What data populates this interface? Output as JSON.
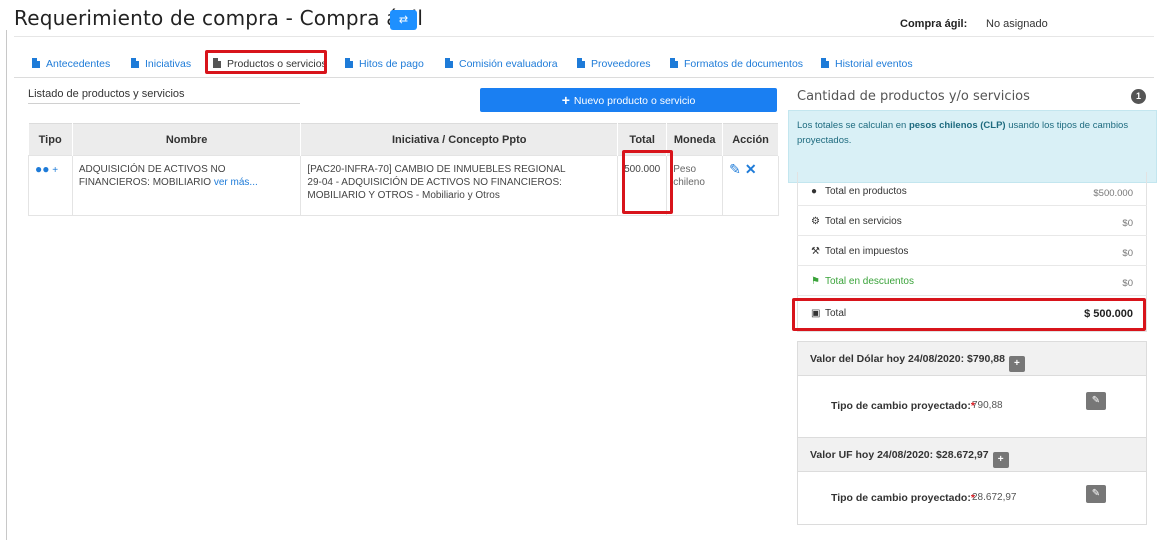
{
  "header": {
    "title": "Requerimiento de compra - Compra ágil",
    "swap_icon": "⇄",
    "compra_agil_label": "Compra ágil:",
    "compra_agil_value": "No asignado"
  },
  "tabs": [
    {
      "label": "Antecedentes"
    },
    {
      "label": "Iniciativas"
    },
    {
      "label": "Productos o servicios"
    },
    {
      "label": "Hitos de pago"
    },
    {
      "label": "Comisión evaluadora"
    },
    {
      "label": "Proveedores"
    },
    {
      "label": "Formatos de documentos"
    },
    {
      "label": "Historial eventos"
    }
  ],
  "list": {
    "title": "Listado de productos y servicios",
    "new_button": "Nuevo producto o servicio",
    "columns": [
      "Tipo",
      "Nombre",
      "Iniciativa / Concepto Ppto",
      "Total",
      "Moneda",
      "Acción"
    ],
    "rows": [
      {
        "tipo": "+",
        "nombre": "ADQUISICIÓN DE ACTIVOS NO FINANCIEROS: MOBILIARIO",
        "ver_mas": "ver más...",
        "iniciativa_line1": "[PAC20-INFRA-70] CAMBIO DE INMUEBLES REGIONAL",
        "iniciativa_line2": "29-04 - ADQUISICIÓN DE ACTIVOS NO FINANCIEROS: MOBILIARIO Y OTROS - Mobiliario y Otros",
        "total": "500.000",
        "moneda": "Peso chileno"
      }
    ]
  },
  "summary": {
    "title": "Cantidad de productos y/o servicios",
    "count": "1",
    "info_prefix": "Los totales se calculan en ",
    "info_bold": "pesos chilenos (CLP)",
    "info_suffix": " usando los tipos de cambios proyectados.",
    "totals": [
      {
        "label": "Total en productos",
        "value": "$500.000"
      },
      {
        "label": "Total en servicios",
        "value": "$0"
      },
      {
        "label": "Total en impuestos",
        "value": "$0"
      },
      {
        "label": "Total en descuentos",
        "value": "$0"
      },
      {
        "label": "Total",
        "value": "$ 500.000"
      }
    ]
  },
  "dolar": {
    "heading": "Valor del Dólar hoy 24/08/2020: $790,88",
    "label": "Tipo de cambio proyectado:",
    "required": "*",
    "value": "790,88"
  },
  "uf": {
    "heading": "Valor UF hoy 24/08/2020: $28.672,97",
    "label": "Tipo de cambio proyectado:",
    "required": "*",
    "value": "28.672,97"
  },
  "colors": {
    "accent": "#1a7ff2",
    "highlight": "#d8141b",
    "info_bg": "#d9f0f6",
    "discount_green": "#3aa33a"
  }
}
